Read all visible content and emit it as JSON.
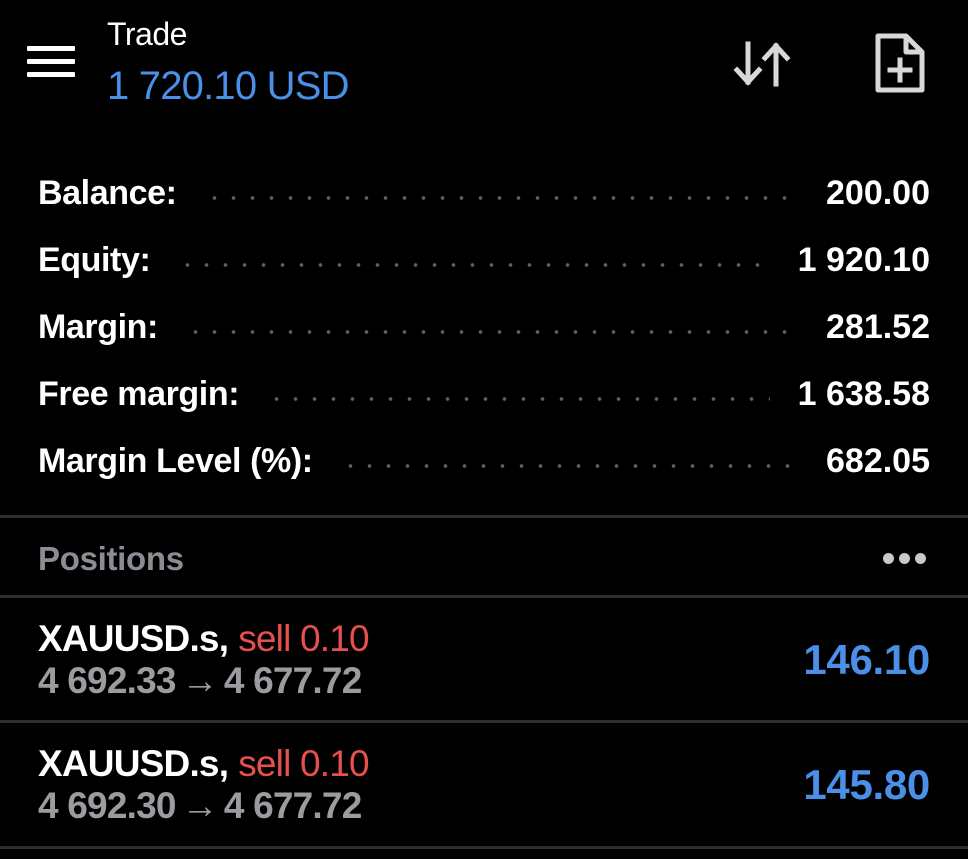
{
  "header": {
    "title": "Trade",
    "subtitle": "1 720.10 USD",
    "menu_icon": "hamburger-menu-icon",
    "sort_icon": "sort-arrows-icon",
    "new_order_icon": "new-document-plus-icon"
  },
  "account": {
    "rows": [
      {
        "label": "Balance:",
        "value": "200.00"
      },
      {
        "label": "Equity:",
        "value": "1 920.10"
      },
      {
        "label": "Margin:",
        "value": "281.52"
      },
      {
        "label": "Free margin:",
        "value": "1 638.58"
      },
      {
        "label": "Margin Level (%):",
        "value": "682.05"
      }
    ]
  },
  "positions": {
    "title": "Positions",
    "more_icon": "more-dots-icon",
    "items": [
      {
        "symbol": "XAUUSD.s,",
        "side": "sell 0.10",
        "open_price": "4 692.33",
        "arrow": "→",
        "current_price": "4 677.72",
        "profit": "146.10"
      },
      {
        "symbol": "XAUUSD.s,",
        "side": "sell 0.10",
        "open_price": "4 692.30",
        "arrow": "→",
        "current_price": "4 677.72",
        "profit": "145.80"
      }
    ]
  },
  "colors": {
    "background": "#000000",
    "accent_blue": "#4a8fe8",
    "sell_red": "#e8504f",
    "muted_gray": "#9a9ca0",
    "divider": "#2b2d31"
  }
}
